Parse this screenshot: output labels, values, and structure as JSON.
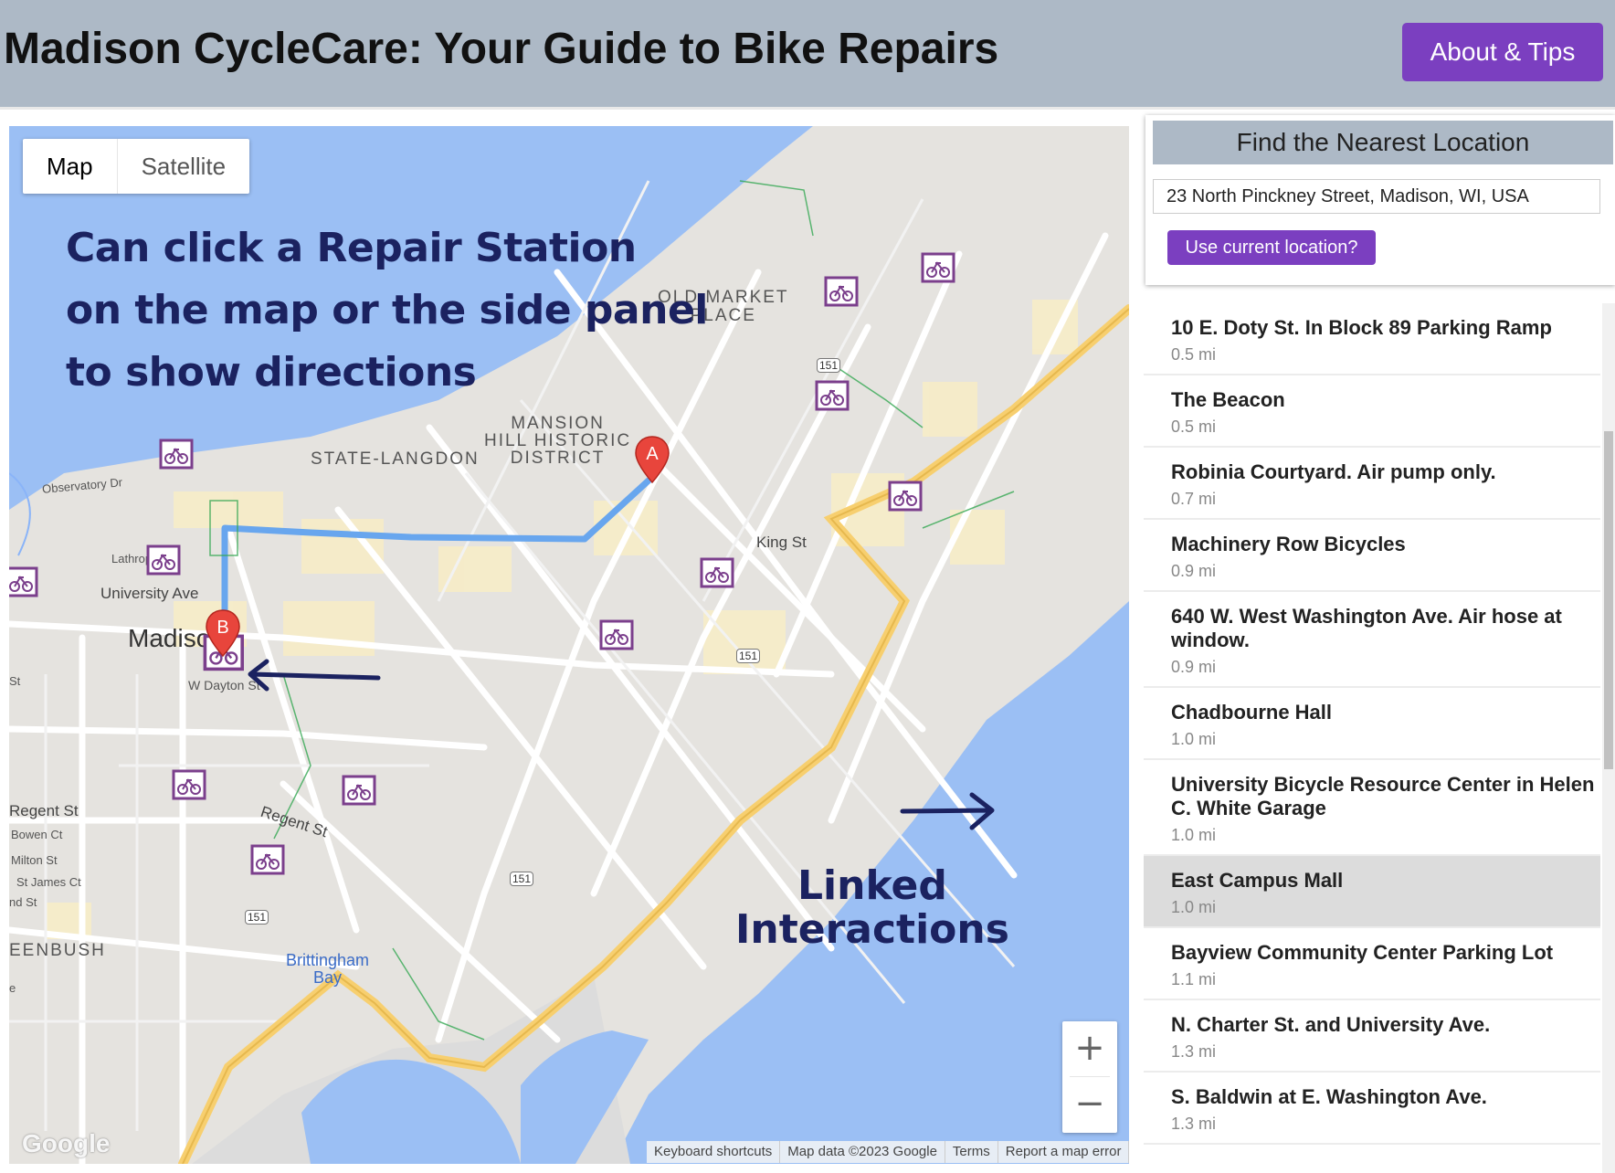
{
  "header": {
    "title": "Madison CycleCare: Your Guide to Bike Repairs",
    "about_label": "About & Tips"
  },
  "map": {
    "type_tabs": [
      "Map",
      "Satellite"
    ],
    "callout_lines": [
      "Can click a Repair Station",
      "on the map or the side panel",
      "to show directions"
    ],
    "linked_lines": [
      "Linked",
      "Interactions"
    ],
    "marker_a": "A",
    "marker_b": "B",
    "zoom_in": "+",
    "zoom_out": "−",
    "logo": "Google",
    "attribution": [
      "Keyboard shortcuts",
      "Map data ©2023 Google",
      "Terms",
      "Report a map error"
    ],
    "labels": {
      "old_market": [
        "OLD MARKET",
        "PLACE"
      ],
      "mansion": [
        "MANSION",
        "HILL HISTORIC",
        "DISTRICT"
      ],
      "state_langdon": "STATE-LANGDON",
      "madison": "Madiso",
      "university_ave": "University Ave",
      "king_st": "King St",
      "regent_st": "Regent St",
      "regent_st_left": "Regent St",
      "brittingham": [
        "Brittingham",
        "Bay"
      ],
      "greenbush": "EENBUSH",
      "w_dayton_st": "W Dayton St",
      "observatory_dr": "Observatory Dr",
      "bowen_ct": "Bowen Ct",
      "milton_st": "Milton St",
      "st_james_ct": "St James Ct",
      "lathrop": "Lathrop",
      "nd_st": "nd St",
      "st": "St",
      "e": "e",
      "route_151": "151"
    },
    "colors": {
      "water": "#9bbff4",
      "land": "#e5e3df",
      "route": "#68a6ee",
      "highway": "#f7cf6f",
      "marker": "#e8453c",
      "station": "#7b3f8c"
    }
  },
  "finder": {
    "heading": "Find the Nearest Location",
    "address_value": "23 North Pinckney Street, Madison, WI, USA",
    "use_location_label": "Use current location?"
  },
  "locations": [
    {
      "name": "10 E. Doty St. In Block 89 Parking Ramp",
      "dist": "0.5 mi"
    },
    {
      "name": "The Beacon",
      "dist": "0.5 mi"
    },
    {
      "name": "Robinia Courtyard. Air pump only.",
      "dist": "0.7 mi"
    },
    {
      "name": "Machinery Row Bicycles",
      "dist": "0.9 mi"
    },
    {
      "name": "640 W. West Washington Ave. Air hose at window.",
      "dist": "0.9 mi"
    },
    {
      "name": "Chadbourne Hall",
      "dist": "1.0 mi"
    },
    {
      "name": "University Bicycle Resource Center in Helen C. White Garage",
      "dist": "1.0 mi"
    },
    {
      "name": "East Campus Mall",
      "dist": "1.0 mi"
    },
    {
      "name": "Bayview Community Center Parking Lot",
      "dist": "1.1 mi"
    },
    {
      "name": "N. Charter St. and University Ave.",
      "dist": "1.3 mi"
    },
    {
      "name": "S. Baldwin at E. Washington Ave.",
      "dist": "1.3 mi"
    }
  ]
}
